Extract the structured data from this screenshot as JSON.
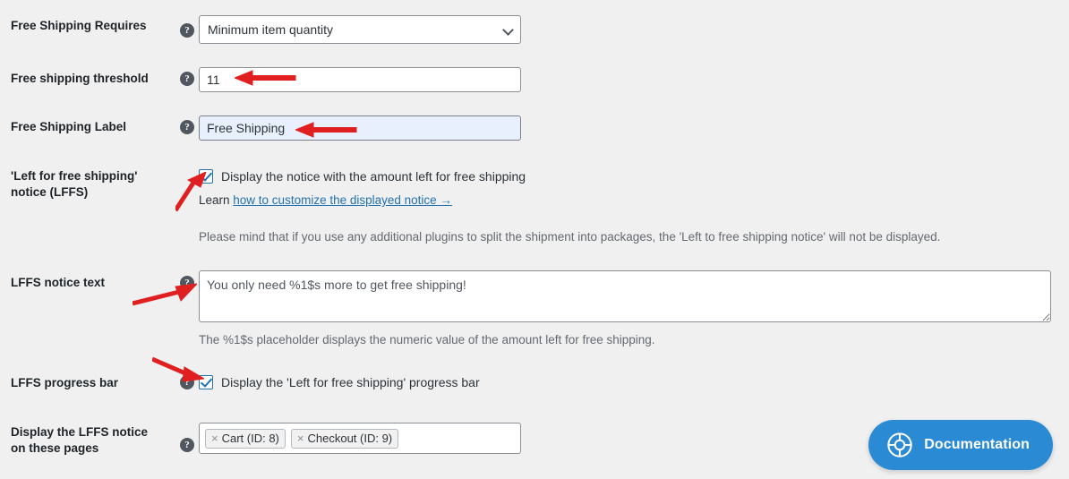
{
  "page": {
    "background": "#f0f0f1",
    "accent": "#2271b1"
  },
  "rows": [
    {
      "label": "Free Shipping Requires",
      "help": "?",
      "control": "select",
      "value": "Minimum item quantity"
    },
    {
      "label": "Free shipping threshold",
      "help": "?",
      "control": "text",
      "value": "11"
    },
    {
      "label": "Free Shipping Label",
      "help": "?",
      "control": "text",
      "value": "Free Shipping"
    },
    {
      "label": "'Left for free shipping' notice (LFFS)",
      "control": "checkbox",
      "checkbox_label": "Display the notice with the amount left for free shipping",
      "checked": true,
      "learn_prefix": "Learn ",
      "learn_link": "how to customize the displayed notice →",
      "note": "Please mind that if you use any additional plugins to split the shipment into packages, the 'Left to free shipping notice' will not be displayed."
    },
    {
      "label": "LFFS notice text",
      "help": "?",
      "control": "textarea",
      "value": "You only need %1$s more to get free shipping!",
      "note": "The %1$s placeholder displays the numeric value of the amount left for free shipping."
    },
    {
      "label": "LFFS progress bar",
      "help": "?",
      "control": "checkbox",
      "checkbox_label": "Display the 'Left for free shipping' progress bar",
      "checked": true
    },
    {
      "label": "Display the LFFS notice on these pages",
      "help": "?",
      "control": "tags",
      "tags": [
        {
          "remove": "×",
          "text": "Cart (ID: 8)"
        },
        {
          "remove": "×",
          "text": "Checkout (ID: 9)"
        }
      ]
    }
  ],
  "documentation": {
    "label": "Documentation",
    "icon": "lifebuoy-icon",
    "color": "#2b8ad4"
  },
  "annotations": {
    "color": "#e02020",
    "arrows": [
      {
        "name": "arrow-to-threshold-field"
      },
      {
        "name": "arrow-to-label-field"
      },
      {
        "name": "arrow-to-lffs-checkbox"
      },
      {
        "name": "arrow-to-notice-text"
      },
      {
        "name": "arrow-to-progress-bar-checkbox"
      }
    ]
  }
}
